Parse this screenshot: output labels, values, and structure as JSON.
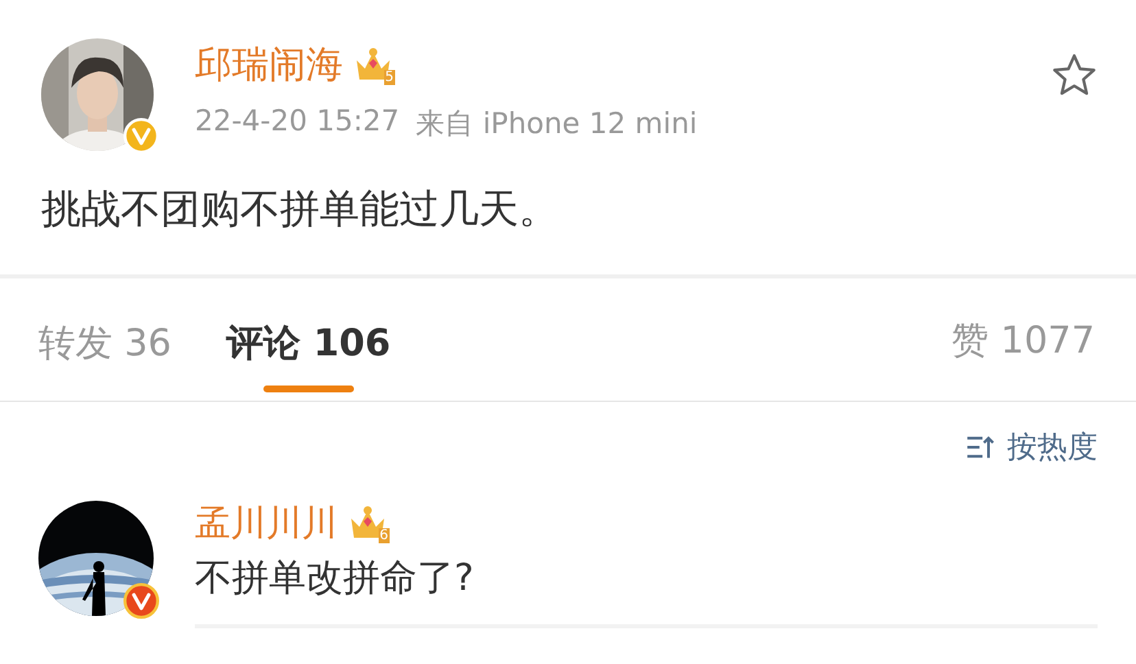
{
  "post": {
    "author": "邱瑞闹海",
    "crown_level": "5",
    "verified": {
      "color": "#f3b51c"
    },
    "time": "22-4-20 15:27",
    "source": "来自 iPhone 12 mini",
    "text": "挑战不团购不拼单能过几天。",
    "favorited": false
  },
  "tabs": [
    {
      "label": "转发",
      "count": "36",
      "selected": false
    },
    {
      "label": "评论",
      "count": "106",
      "selected": true
    }
  ],
  "likes": {
    "label": "赞",
    "count": "1077"
  },
  "sort": {
    "label": "按热度"
  },
  "comments": [
    {
      "author": "孟川川川",
      "crown_level": "6",
      "verified": {
        "color": "#e8481c"
      },
      "text": "不拼单改拼命了?"
    }
  ]
}
